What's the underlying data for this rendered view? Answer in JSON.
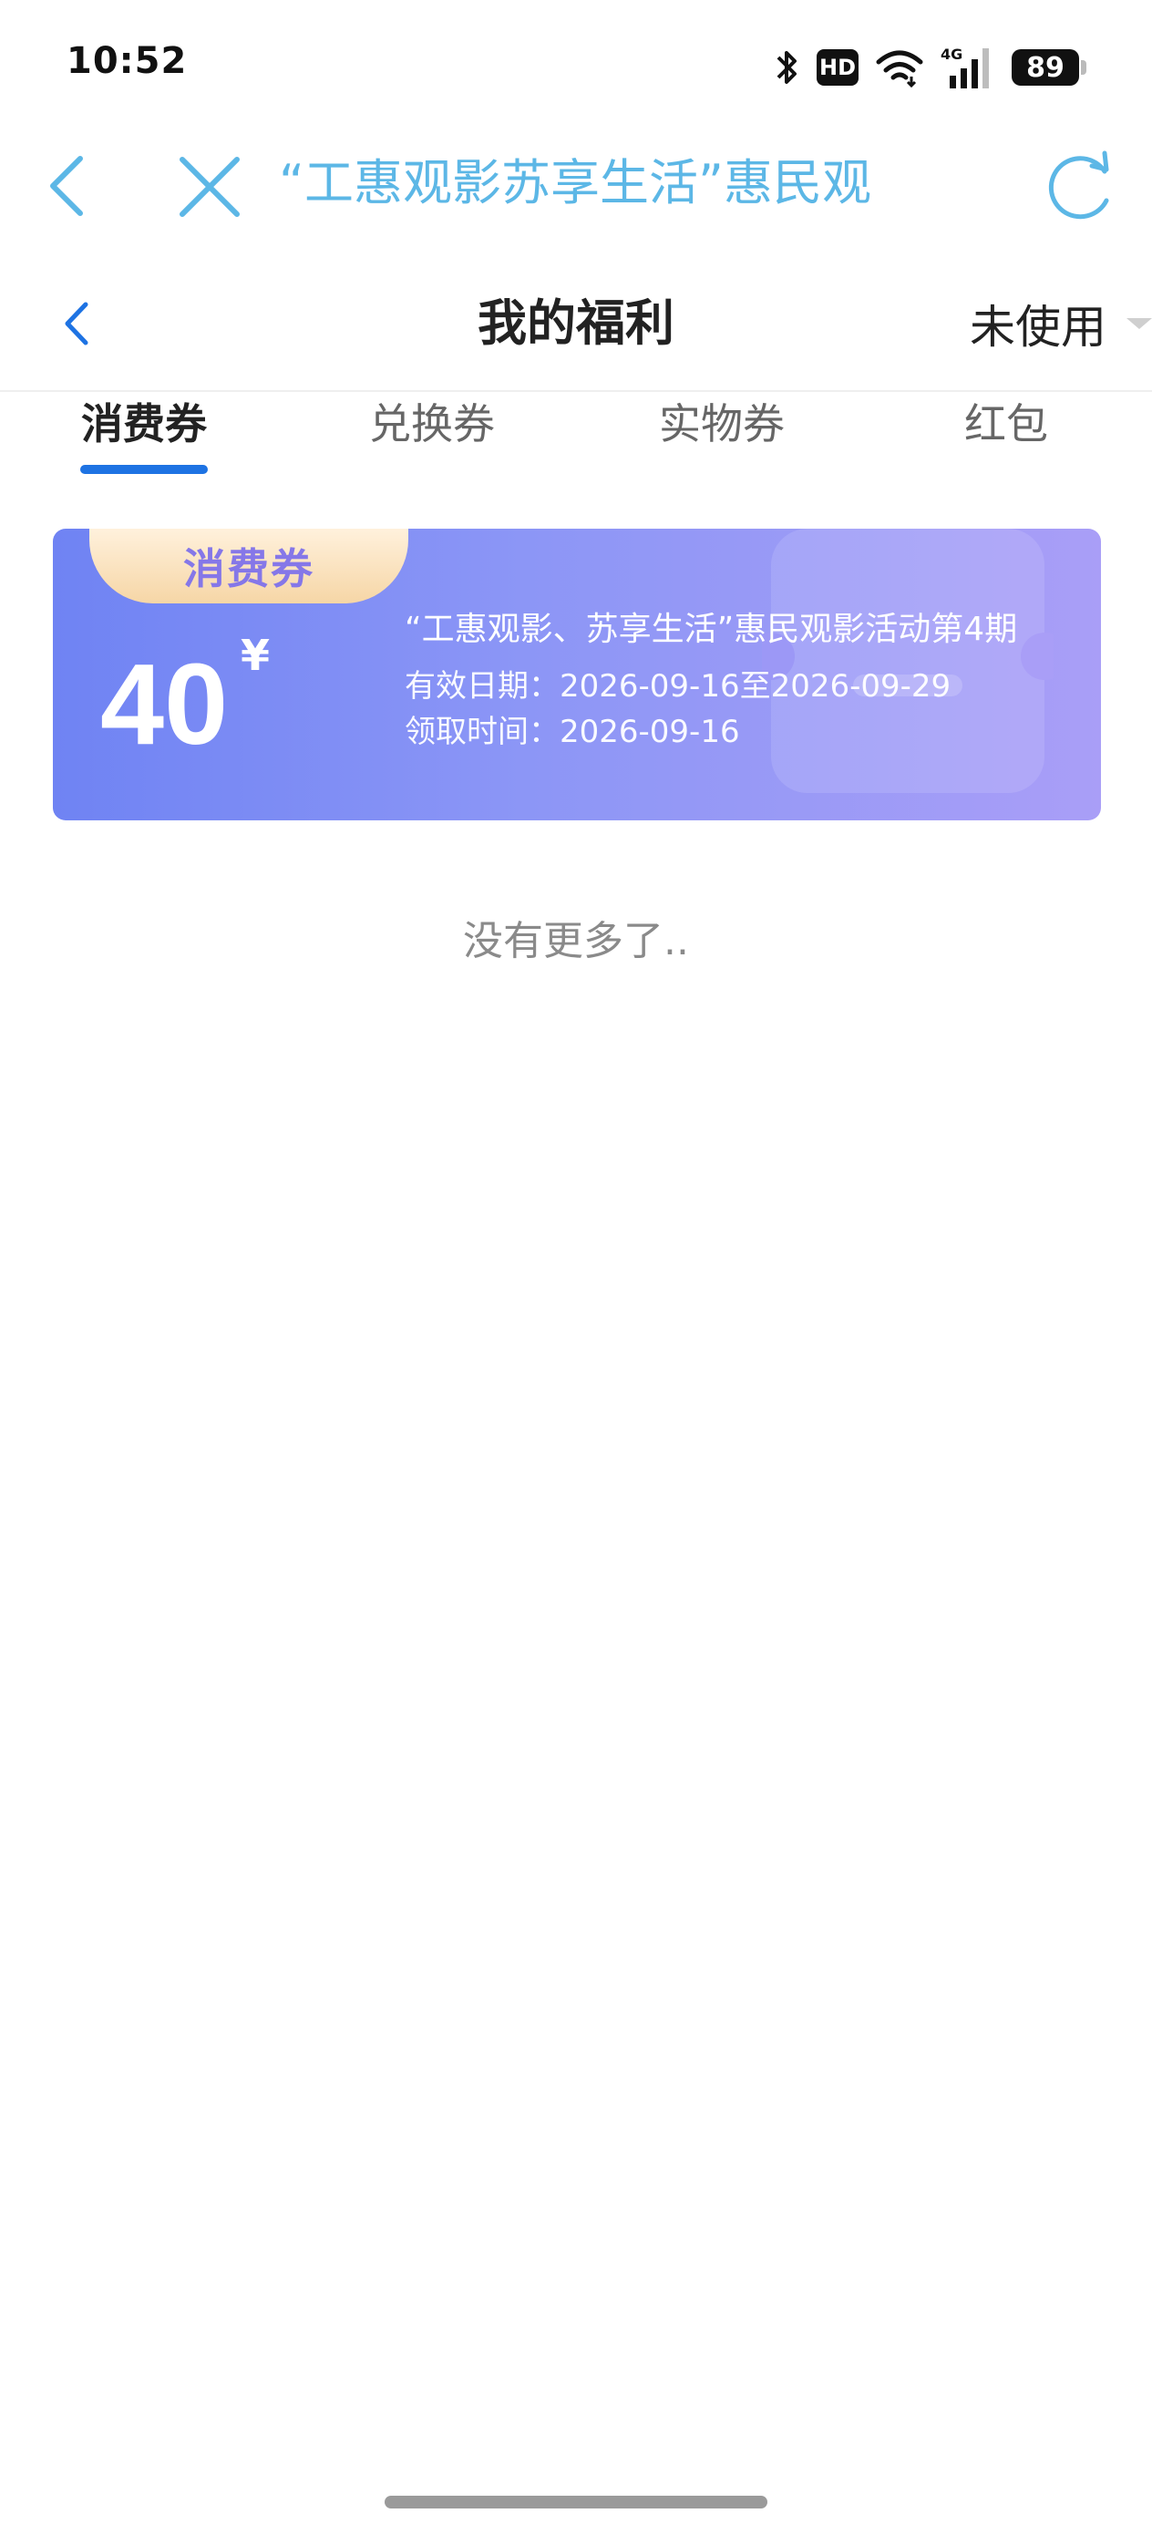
{
  "status_bar": {
    "time": "10:52",
    "hd_label": "HD",
    "network_label": "4G",
    "battery": "89",
    "icons": [
      "bluetooth-icon",
      "hd-icon",
      "wifi-icon",
      "signal-4g-icon",
      "battery-icon"
    ]
  },
  "web_toolbar": {
    "title": "“工惠观影苏享生活”惠民观",
    "back_icon": "chevron-left-icon",
    "close_icon": "close-icon",
    "refresh_icon": "refresh-icon",
    "accent_color": "#5cb7e6"
  },
  "page_header": {
    "title": "我的福利",
    "filter_label": "未使用",
    "back_icon": "chevron-left-icon",
    "back_color": "#1e73e3"
  },
  "tabs": [
    {
      "label": "消费券",
      "active": true
    },
    {
      "label": "兑换券",
      "active": false
    },
    {
      "label": "实物券",
      "active": false
    },
    {
      "label": "红包",
      "active": false
    }
  ],
  "tab_accent_color": "#1e73e3",
  "coupons": [
    {
      "tag": "消费券",
      "amount": "40",
      "currency": "¥",
      "name": "“工惠观影、苏享生活”惠民观影活动第4期",
      "validity_label": "有效日期：",
      "validity": "2026-09-16至2026-09-29",
      "claim_label": "领取时间：",
      "claim_time": "2026-09-16",
      "gradient": [
        "#6f83f3",
        "#a99ef7"
      ]
    }
  ],
  "list_end_text": "没有更多了.."
}
